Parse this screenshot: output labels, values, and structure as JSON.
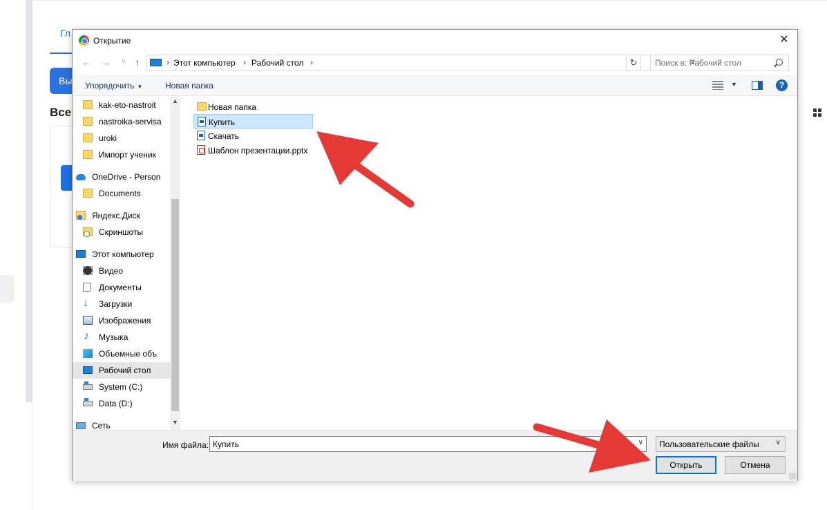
{
  "background": {
    "tab_label": "Гл",
    "button_label": "Вы",
    "heading": "Все"
  },
  "dialog": {
    "title": "Открытие",
    "close_glyph": "✕",
    "nav": {
      "back": "←",
      "forward": "→",
      "recent": "˅",
      "up": "↑"
    },
    "breadcrumb": [
      "Этот компьютер",
      "Рабочий стол"
    ],
    "crumb_sep": "›",
    "refresh_glyph": "↻",
    "search_placeholder": "Поиск в: Рабочий стол",
    "toolbar": {
      "organize": "Упорядочить",
      "new_folder": "Новая папка",
      "caret": "▼",
      "help": "?"
    },
    "nav_items": [
      {
        "label": "kak-eto-nastroit",
        "icon": "folder-icon"
      },
      {
        "label": "nastroika-servisa",
        "icon": "folder-icon"
      },
      {
        "label": "uroki",
        "icon": "folder-icon"
      },
      {
        "label": "Импорт ученик",
        "icon": "folder-icon"
      },
      {
        "label": "OneDrive - Person",
        "icon": "cloud-icon"
      },
      {
        "label": "Documents",
        "icon": "folder-icon"
      },
      {
        "label": "Яндекс.Диск",
        "icon": "yandex-disk-icon"
      },
      {
        "label": "Скриншоты",
        "icon": "screenshots-folder-icon"
      },
      {
        "label": "Этот компьютер",
        "icon": "computer-icon"
      },
      {
        "label": "Видео",
        "icon": "video-icon"
      },
      {
        "label": "Документы",
        "icon": "documents-icon"
      },
      {
        "label": "Загрузки",
        "icon": "downloads-icon"
      },
      {
        "label": "Изображения",
        "icon": "pictures-icon"
      },
      {
        "label": "Музыка",
        "icon": "music-icon"
      },
      {
        "label": "Объемные объ",
        "icon": "3d-objects-icon"
      },
      {
        "label": "Рабочий стол",
        "icon": "desktop-icon",
        "selected": true
      },
      {
        "label": "System (C:)",
        "icon": "drive-icon"
      },
      {
        "label": "Data (D:)",
        "icon": "drive-icon"
      },
      {
        "label": "Сеть",
        "icon": "network-icon"
      }
    ],
    "files": [
      {
        "label": "Новая папка",
        "icon": "folder-icon"
      },
      {
        "label": "Купить",
        "icon": "document-icon",
        "selected": true
      },
      {
        "label": "Скачать",
        "icon": "document-icon"
      },
      {
        "label": "Шаблон презентации.pptx",
        "icon": "pdf-icon"
      }
    ],
    "filename_label": "Имя файла:",
    "filename_value": "Купить",
    "filetype_value": "Пользовательские файлы",
    "open_button": "Открыть",
    "cancel_button": "Отмена",
    "dropdown_glyph": "∨"
  },
  "colors": {
    "accent": "#1f6fe5",
    "annotation_arrow": "#e53935",
    "selection": "#cce8ff"
  }
}
